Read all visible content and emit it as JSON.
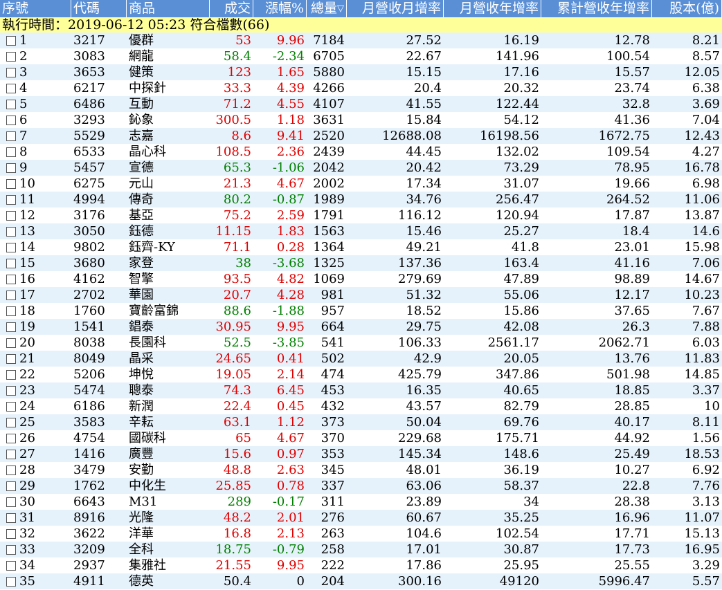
{
  "header": {
    "columns": [
      "序號",
      "代碼",
      "商品",
      "成交",
      "漲幅%",
      "總量",
      "月營收月增率",
      "月營收年增率",
      "累計營收年增率",
      "股本(億)"
    ],
    "sort_indicator": "▽"
  },
  "status": "執行時間：2019-06-12 05:23 符合檔數(66)",
  "rows": [
    {
      "seq": "1",
      "code": "3217",
      "name": "優群",
      "price": "53",
      "chg": "9.96",
      "vol": "7184",
      "mom": "27.52",
      "yoy": "16.19",
      "cum": "12.78",
      "cap": "8.21",
      "dir": "up"
    },
    {
      "seq": "2",
      "code": "3083",
      "name": "網龍",
      "price": "58.4",
      "chg": "-2.34",
      "vol": "6705",
      "mom": "22.67",
      "yoy": "141.96",
      "cum": "100.54",
      "cap": "8.57",
      "dir": "down"
    },
    {
      "seq": "3",
      "code": "3653",
      "name": "健策",
      "price": "123",
      "chg": "1.65",
      "vol": "5880",
      "mom": "15.15",
      "yoy": "17.16",
      "cum": "15.57",
      "cap": "12.05",
      "dir": "up"
    },
    {
      "seq": "4",
      "code": "6217",
      "name": "中探針",
      "price": "33.3",
      "chg": "4.39",
      "vol": "4266",
      "mom": "20.4",
      "yoy": "20.32",
      "cum": "23.74",
      "cap": "6.38",
      "dir": "up"
    },
    {
      "seq": "5",
      "code": "6486",
      "name": "互動",
      "price": "71.2",
      "chg": "4.55",
      "vol": "4107",
      "mom": "41.55",
      "yoy": "122.44",
      "cum": "32.8",
      "cap": "3.69",
      "dir": "up"
    },
    {
      "seq": "6",
      "code": "3293",
      "name": "鈊象",
      "price": "300.5",
      "chg": "1.18",
      "vol": "3631",
      "mom": "15.84",
      "yoy": "54.12",
      "cum": "41.36",
      "cap": "7.04",
      "dir": "up"
    },
    {
      "seq": "7",
      "code": "5529",
      "name": "志嘉",
      "price": "8.6",
      "chg": "9.41",
      "vol": "2520",
      "mom": "12688.08",
      "yoy": "16198.56",
      "cum": "1672.75",
      "cap": "12.43",
      "dir": "up"
    },
    {
      "seq": "8",
      "code": "6533",
      "name": "晶心科",
      "price": "108.5",
      "chg": "2.36",
      "vol": "2439",
      "mom": "44.45",
      "yoy": "132.02",
      "cum": "109.54",
      "cap": "4.27",
      "dir": "up"
    },
    {
      "seq": "9",
      "code": "5457",
      "name": "宣德",
      "price": "65.3",
      "chg": "-1.06",
      "vol": "2042",
      "mom": "20.42",
      "yoy": "73.29",
      "cum": "78.95",
      "cap": "16.78",
      "dir": "down"
    },
    {
      "seq": "10",
      "code": "6275",
      "name": "元山",
      "price": "21.3",
      "chg": "4.67",
      "vol": "2002",
      "mom": "17.34",
      "yoy": "31.07",
      "cum": "19.66",
      "cap": "6.98",
      "dir": "up"
    },
    {
      "seq": "11",
      "code": "4994",
      "name": "傳奇",
      "price": "80.2",
      "chg": "-0.87",
      "vol": "1989",
      "mom": "34.76",
      "yoy": "256.47",
      "cum": "264.52",
      "cap": "11.06",
      "dir": "down"
    },
    {
      "seq": "12",
      "code": "3176",
      "name": "基亞",
      "price": "75.2",
      "chg": "2.59",
      "vol": "1791",
      "mom": "116.12",
      "yoy": "120.94",
      "cum": "17.87",
      "cap": "13.87",
      "dir": "up"
    },
    {
      "seq": "13",
      "code": "3050",
      "name": "鈺德",
      "price": "11.15",
      "chg": "1.83",
      "vol": "1563",
      "mom": "15.46",
      "yoy": "25.27",
      "cum": "18.4",
      "cap": "14.6",
      "dir": "up"
    },
    {
      "seq": "14",
      "code": "9802",
      "name": "鈺齊-KY",
      "price": "71.1",
      "chg": "0.28",
      "vol": "1364",
      "mom": "49.21",
      "yoy": "41.8",
      "cum": "23.01",
      "cap": "15.98",
      "dir": "up"
    },
    {
      "seq": "15",
      "code": "3680",
      "name": "家登",
      "price": "38",
      "chg": "-3.68",
      "vol": "1325",
      "mom": "137.36",
      "yoy": "163.4",
      "cum": "41.16",
      "cap": "7.06",
      "dir": "down"
    },
    {
      "seq": "16",
      "code": "4162",
      "name": "智擎",
      "price": "93.5",
      "chg": "4.82",
      "vol": "1069",
      "mom": "279.69",
      "yoy": "47.89",
      "cum": "98.89",
      "cap": "14.67",
      "dir": "up"
    },
    {
      "seq": "17",
      "code": "2702",
      "name": "華園",
      "price": "20.7",
      "chg": "4.28",
      "vol": "981",
      "mom": "51.32",
      "yoy": "55.06",
      "cum": "12.17",
      "cap": "10.23",
      "dir": "up"
    },
    {
      "seq": "18",
      "code": "1760",
      "name": "寶齡富錦",
      "price": "88.6",
      "chg": "-1.88",
      "vol": "957",
      "mom": "18.52",
      "yoy": "15.86",
      "cum": "37.65",
      "cap": "7.67",
      "dir": "down"
    },
    {
      "seq": "19",
      "code": "1541",
      "name": "錩泰",
      "price": "30.95",
      "chg": "9.95",
      "vol": "664",
      "mom": "29.75",
      "yoy": "42.08",
      "cum": "26.3",
      "cap": "7.88",
      "dir": "up"
    },
    {
      "seq": "20",
      "code": "8038",
      "name": "長園科",
      "price": "52.5",
      "chg": "-3.85",
      "vol": "541",
      "mom": "106.33",
      "yoy": "2561.17",
      "cum": "2062.71",
      "cap": "6.03",
      "dir": "down"
    },
    {
      "seq": "21",
      "code": "8049",
      "name": "晶采",
      "price": "24.65",
      "chg": "0.41",
      "vol": "502",
      "mom": "42.9",
      "yoy": "20.05",
      "cum": "13.76",
      "cap": "11.83",
      "dir": "up"
    },
    {
      "seq": "22",
      "code": "5206",
      "name": "坤悅",
      "price": "19.05",
      "chg": "2.14",
      "vol": "474",
      "mom": "425.79",
      "yoy": "347.86",
      "cum": "501.98",
      "cap": "14.85",
      "dir": "up"
    },
    {
      "seq": "23",
      "code": "5474",
      "name": "聰泰",
      "price": "74.3",
      "chg": "6.45",
      "vol": "453",
      "mom": "16.35",
      "yoy": "40.65",
      "cum": "18.85",
      "cap": "3.37",
      "dir": "up"
    },
    {
      "seq": "24",
      "code": "6186",
      "name": "新潤",
      "price": "22.4",
      "chg": "0.45",
      "vol": "432",
      "mom": "43.57",
      "yoy": "82.79",
      "cum": "28.85",
      "cap": "10",
      "dir": "up"
    },
    {
      "seq": "25",
      "code": "3583",
      "name": "辛耘",
      "price": "63.1",
      "chg": "1.12",
      "vol": "373",
      "mom": "50.04",
      "yoy": "69.76",
      "cum": "40.17",
      "cap": "8.11",
      "dir": "up"
    },
    {
      "seq": "26",
      "code": "4754",
      "name": "國碳科",
      "price": "65",
      "chg": "4.67",
      "vol": "370",
      "mom": "229.68",
      "yoy": "175.71",
      "cum": "44.92",
      "cap": "1.56",
      "dir": "up"
    },
    {
      "seq": "27",
      "code": "1416",
      "name": "廣豐",
      "price": "15.6",
      "chg": "0.97",
      "vol": "353",
      "mom": "145.34",
      "yoy": "148.6",
      "cum": "25.49",
      "cap": "18.53",
      "dir": "up"
    },
    {
      "seq": "28",
      "code": "3479",
      "name": "安勤",
      "price": "48.8",
      "chg": "2.63",
      "vol": "345",
      "mom": "48.01",
      "yoy": "36.19",
      "cum": "10.27",
      "cap": "6.92",
      "dir": "up"
    },
    {
      "seq": "29",
      "code": "1762",
      "name": "中化生",
      "price": "25.85",
      "chg": "0.78",
      "vol": "337",
      "mom": "63.06",
      "yoy": "58.37",
      "cum": "22.8",
      "cap": "7.76",
      "dir": "up"
    },
    {
      "seq": "30",
      "code": "6643",
      "name": "M31",
      "price": "289",
      "chg": "-0.17",
      "vol": "311",
      "mom": "23.89",
      "yoy": "34",
      "cum": "28.38",
      "cap": "3.13",
      "dir": "down"
    },
    {
      "seq": "31",
      "code": "8916",
      "name": "光隆",
      "price": "48.2",
      "chg": "2.01",
      "vol": "276",
      "mom": "60.67",
      "yoy": "35.25",
      "cum": "16.96",
      "cap": "11.07",
      "dir": "up"
    },
    {
      "seq": "32",
      "code": "3622",
      "name": "洋華",
      "price": "16.8",
      "chg": "2.13",
      "vol": "263",
      "mom": "104.6",
      "yoy": "102.54",
      "cum": "17.71",
      "cap": "15.13",
      "dir": "up"
    },
    {
      "seq": "33",
      "code": "3209",
      "name": "全科",
      "price": "18.75",
      "chg": "-0.79",
      "vol": "258",
      "mom": "17.01",
      "yoy": "30.87",
      "cum": "17.73",
      "cap": "16.95",
      "dir": "down"
    },
    {
      "seq": "34",
      "code": "2937",
      "name": "集雅社",
      "price": "21.55",
      "chg": "9.95",
      "vol": "222",
      "mom": "17.86",
      "yoy": "25.95",
      "cum": "25.55",
      "cap": "3.29",
      "dir": "up"
    },
    {
      "seq": "35",
      "code": "4911",
      "name": "德英",
      "price": "50.4",
      "chg": "0",
      "vol": "204",
      "mom": "300.16",
      "yoy": "49120",
      "cum": "5996.47",
      "cap": "5.57",
      "dir": "flat"
    }
  ]
}
